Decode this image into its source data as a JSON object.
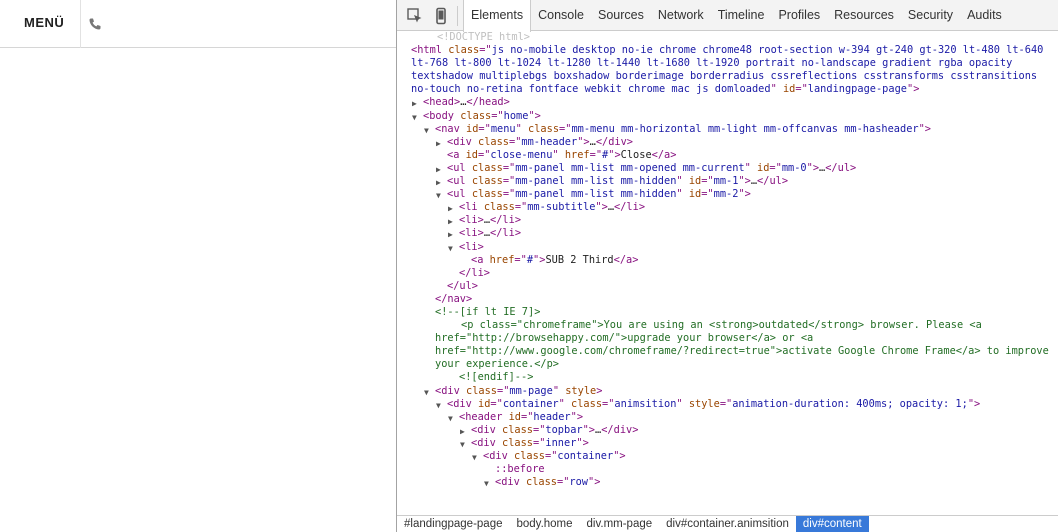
{
  "site": {
    "menu_label": "MENÜ",
    "phone_icon": "phone-icon"
  },
  "devtools": {
    "icons": [
      "inspect-element-icon",
      "device-mode-icon"
    ],
    "tabs": [
      "Elements",
      "Console",
      "Sources",
      "Network",
      "Timeline",
      "Profiles",
      "Resources",
      "Security",
      "Audits"
    ],
    "active_tab": "Elements",
    "tree": {
      "doctype": "<!DOCTYPE html>",
      "html_tag": "html",
      "html_class": "js no-mobile desktop no-ie chrome chrome48 root-section w-394 gt-240 gt-320 lt-480 lt-640 lt-768 lt-800 lt-1024 lt-1280 lt-1440 lt-1680 lt-1920 portrait no-landscape gradient rgba opacity textshadow multiplebgs boxshadow borderimage borderradius cssreflections csstransforms csstransitions no-touch no-retina fontface webkit chrome mac js domloaded",
      "html_id": "landingpage-page",
      "head": "head",
      "body_tag": "body",
      "body_class": "home",
      "nav_id": "menu",
      "nav_class": "mm-menu mm-horizontal mm-light mm-offcanvas mm-hasheader",
      "div_header_class": "mm-header",
      "close_id": "close-menu",
      "close_href": "#",
      "close_text": "Close",
      "ul0_class": "mm-panel mm-list mm-opened mm-current",
      "ul0_id": "mm-0",
      "ul1_class": "mm-panel mm-list mm-hidden",
      "ul1_id": "mm-1",
      "ul2_class": "mm-panel mm-list mm-hidden",
      "ul2_id": "mm-2",
      "li_subtitle_class": "mm-subtitle",
      "sub_href": "#",
      "sub_text": "SUB 2 Third",
      "cond_open": "<!--[if lt IE 7]>",
      "p_class": "chromeframe",
      "p_text1": "You are using an ",
      "p_text2": "outdated",
      "p_text3": " browser. Please ",
      "p_href1": "http://browsehappy.com/",
      "p_text4": "upgrade your browser",
      "p_text5": " or ",
      "p_href2": "http://www.google.com/chromeframe/?redirect=true",
      "p_text6": "activate Google Chrome Frame",
      "p_text7": " to improve your experience.",
      "cond_close": "<![endif]-->",
      "mm_page_class": "mm-page",
      "mm_page_style": "style",
      "container_id": "container",
      "container_class": "animsition",
      "container_style": "animation-duration: 400ms; opacity: 1;",
      "header_id": "header",
      "topbar_class": "topbar",
      "inner_class": "inner",
      "inner_container_class": "container",
      "before": "::before",
      "row_class": "row"
    },
    "breadcrumbs": [
      "#landingpage-page",
      "body.home",
      "div.mm-page",
      "div#container.animsition",
      "div#content"
    ],
    "active_breadcrumb": "div#content"
  }
}
